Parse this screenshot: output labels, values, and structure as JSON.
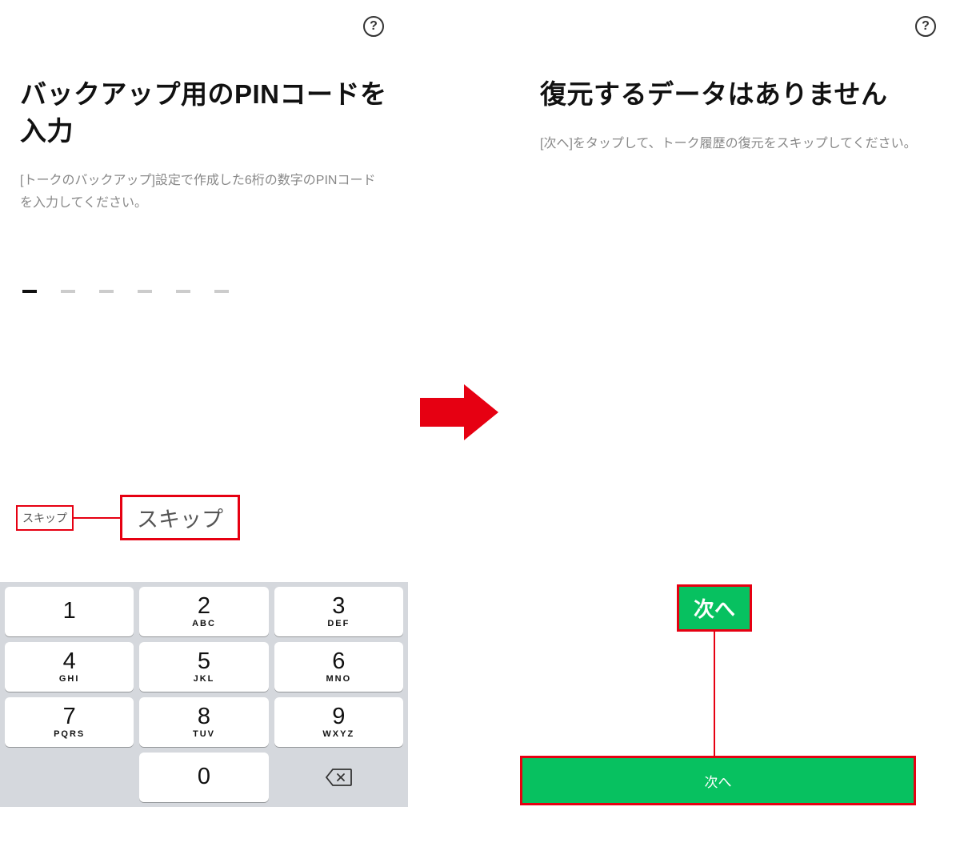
{
  "left_screen": {
    "title": "バックアップ用のPINコードを入力",
    "subtitle": "[トークのバックアップ]設定で作成した6桁の数字のPINコードを入力してください。",
    "pin_length": 6,
    "pin_active_index": 0,
    "skip_annotation_label": "スキップ",
    "skip_button_label": "スキップ",
    "keypad": {
      "rows": [
        [
          {
            "num": "1",
            "letters": ""
          },
          {
            "num": "2",
            "letters": "ABC"
          },
          {
            "num": "3",
            "letters": "DEF"
          }
        ],
        [
          {
            "num": "4",
            "letters": "GHI"
          },
          {
            "num": "5",
            "letters": "JKL"
          },
          {
            "num": "6",
            "letters": "MNO"
          }
        ],
        [
          {
            "num": "7",
            "letters": "PQRS"
          },
          {
            "num": "8",
            "letters": "TUV"
          },
          {
            "num": "9",
            "letters": "WXYZ"
          }
        ],
        [
          {
            "spacer": true
          },
          {
            "num": "0",
            "letters": ""
          },
          {
            "backspace": true
          }
        ]
      ]
    }
  },
  "right_screen": {
    "title": "復元するデータはありません",
    "subtitle": "[次へ]をタップして、トーク履歴の復元をスキップしてください。",
    "next_annotation_label": "次へ",
    "next_button_label": "次へ"
  },
  "colors": {
    "highlight_red": "#e60012",
    "button_green": "#07c160"
  }
}
